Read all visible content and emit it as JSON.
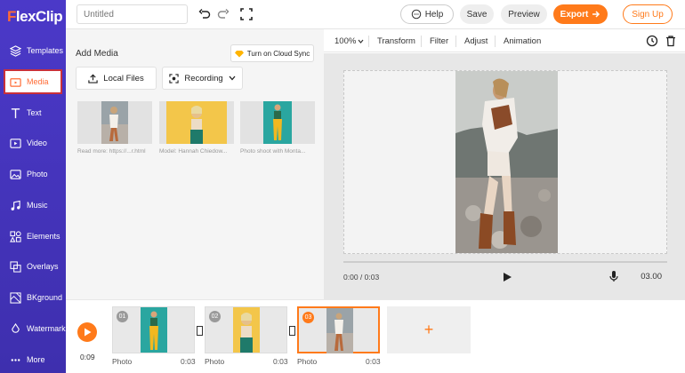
{
  "app": {
    "logo_first": "F",
    "logo_rest": "lexClip"
  },
  "topbar": {
    "title_placeholder": "Untitled",
    "help_label": "Help",
    "save_label": "Save",
    "preview_label": "Preview",
    "export_label": "Export",
    "signup_label": "Sign Up"
  },
  "sidebar": {
    "items": [
      {
        "label": "Templates",
        "icon": "layers-icon"
      },
      {
        "label": "Media",
        "icon": "media-folder-icon",
        "active": true
      },
      {
        "label": "Text",
        "icon": "text-icon"
      },
      {
        "label": "Video",
        "icon": "video-icon"
      },
      {
        "label": "Photo",
        "icon": "photo-icon"
      },
      {
        "label": "Music",
        "icon": "music-icon"
      },
      {
        "label": "Elements",
        "icon": "elements-icon"
      },
      {
        "label": "Overlays",
        "icon": "overlays-icon"
      },
      {
        "label": "BKground",
        "icon": "background-icon"
      },
      {
        "label": "Watermark",
        "icon": "watermark-icon"
      },
      {
        "label": "More",
        "icon": "more-icon"
      }
    ]
  },
  "media_panel": {
    "title": "Add Media",
    "cloud_sync_label": "Turn on Cloud Sync",
    "local_files_label": "Local Files",
    "recording_label": "Recording",
    "thumbnails": [
      {
        "caption": "Read more: https://...r.html"
      },
      {
        "caption": "Model: Hannah Chiedow..."
      },
      {
        "caption": "Photo shoot with Monta..."
      }
    ]
  },
  "editor_toolbar": {
    "zoom": "100%",
    "items": [
      "Transform",
      "Filter",
      "Adjust",
      "Animation"
    ]
  },
  "player": {
    "current_time": "0:00 / 0:03",
    "total_time": "03.00"
  },
  "timeline": {
    "total_duration": "0:09",
    "clips": [
      {
        "num": "01",
        "label": "Photo",
        "time": "0:03"
      },
      {
        "num": "02",
        "label": "Photo",
        "time": "0:03"
      },
      {
        "num": "03",
        "label": "Photo",
        "time": "0:03"
      }
    ],
    "add_symbol": "+"
  }
}
